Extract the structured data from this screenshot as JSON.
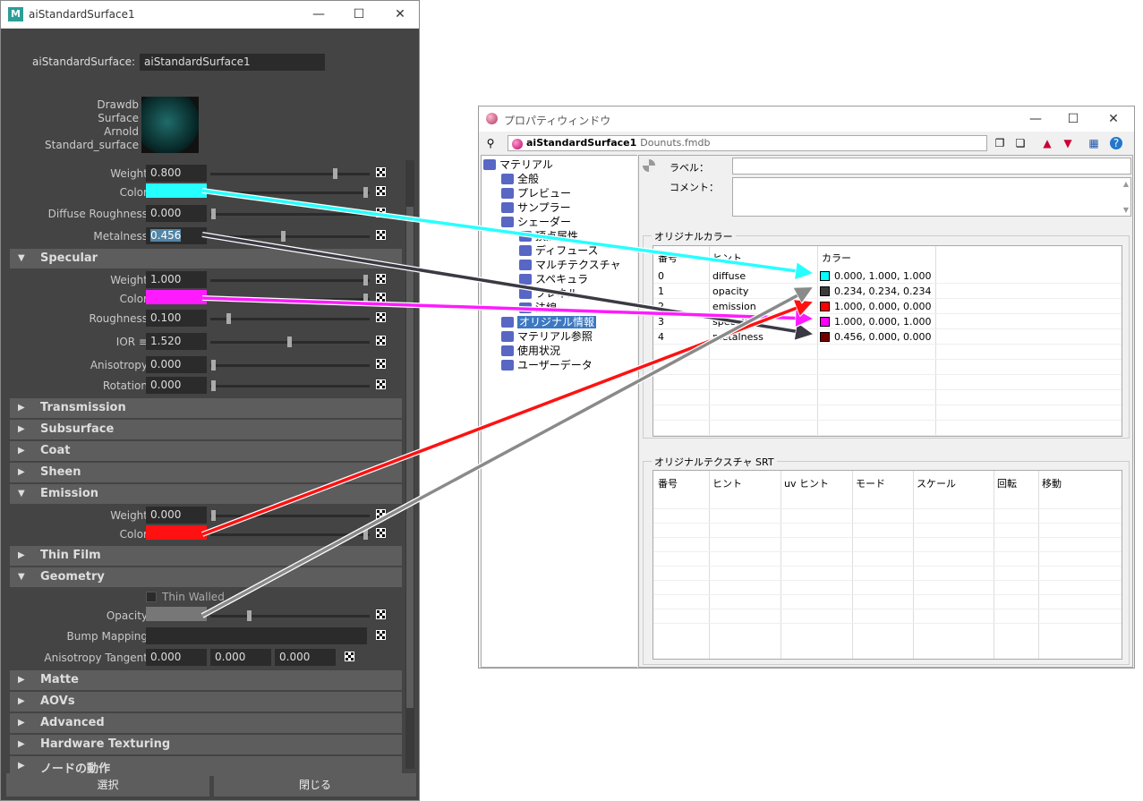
{
  "maya": {
    "title": "aiStandardSurface1",
    "logo": "M",
    "node_label": "aiStandardSurface:",
    "node_value": "aiStandardSurface1",
    "swatch_lines": [
      "Drawdb",
      "Surface",
      "Arnold",
      "Standard_surface"
    ],
    "attrs": [
      {
        "label": "Weight",
        "value": "0.800",
        "slider": 0.8
      },
      {
        "label": "Color",
        "color": "#26ffff",
        "slider": 1.0
      },
      {
        "label": "Diffuse Roughness",
        "value": "0.000",
        "slider": 0.0
      },
      {
        "label": "Metalness",
        "value": "0.456",
        "slider": 0.456,
        "selected": true
      }
    ],
    "specular": {
      "header": "Specular",
      "attrs": [
        {
          "label": "Weight",
          "value": "1.000",
          "slider": 1.0
        },
        {
          "label": "Color",
          "color": "#ff1aff",
          "slider": 1.0
        },
        {
          "label": "Roughness",
          "value": "0.100",
          "slider": 0.1
        },
        {
          "label": "IOR ≡",
          "value": "1.520",
          "slider": 0.5
        },
        {
          "label": "Anisotropy",
          "value": "0.000",
          "slider": 0.0
        },
        {
          "label": "Rotation",
          "value": "0.000",
          "slider": 0.0
        }
      ]
    },
    "sections_mid": [
      "Transmission",
      "Subsurface",
      "Coat",
      "Sheen"
    ],
    "emission": {
      "header": "Emission",
      "attrs": [
        {
          "label": "Weight",
          "value": "0.000",
          "slider": 0.0
        },
        {
          "label": "Color",
          "color": "#ff1111",
          "slider": 1.0
        }
      ]
    },
    "thin_film": "Thin Film",
    "geometry": {
      "header": "Geometry",
      "thin_walled": "Thin Walled",
      "opacity_label": "Opacity",
      "opacity_color": "#777777",
      "opacity_slider": 0.234,
      "bump_label": "Bump Mapping",
      "aniso_label": "Anisotropy Tangent",
      "aniso_values": [
        "0.000",
        "0.000",
        "0.000"
      ]
    },
    "sections_bottom": [
      "Matte",
      "AOVs",
      "Advanced",
      "Hardware Texturing",
      "ノードの動作"
    ],
    "select_button": "選択",
    "close_button": "閉じる"
  },
  "prop": {
    "title": "プロパティウィンドウ",
    "node_name": "aiStandardSurface1",
    "file": "Dounuts.fmdb",
    "tree": [
      {
        "label": "マテリアル",
        "indent": 0
      },
      {
        "label": "全般",
        "indent": 1
      },
      {
        "label": "プレビュー",
        "indent": 1
      },
      {
        "label": "サンプラー",
        "indent": 1
      },
      {
        "label": "シェーダー",
        "indent": 1
      },
      {
        "label": "頂点属性",
        "indent": 2
      },
      {
        "label": "ディフュース",
        "indent": 2
      },
      {
        "label": "マルチテクスチャ",
        "indent": 2
      },
      {
        "label": "スペキュラ",
        "indent": 2
      },
      {
        "label": "フレネル",
        "indent": 2
      },
      {
        "label": "法線",
        "indent": 2
      },
      {
        "label": "オリジナル情報",
        "indent": 1,
        "selected": true
      },
      {
        "label": "マテリアル参照",
        "indent": 1
      },
      {
        "label": "使用状況",
        "indent": 1
      },
      {
        "label": "ユーザーデータ",
        "indent": 1
      }
    ],
    "label_label": "ラベル：",
    "comment_label": "コメント：",
    "orig_color_title": "オリジナルカラー",
    "color_headers": [
      "番号",
      "ヒント",
      "カラー"
    ],
    "colors": [
      {
        "idx": "0",
        "hint": "diffuse",
        "value": "0.000, 1.000, 1.000",
        "swatch": "#00ffff"
      },
      {
        "idx": "1",
        "hint": "opacity",
        "value": "0.234, 0.234, 0.234",
        "swatch": "#3b3b3b"
      },
      {
        "idx": "2",
        "hint": "emission",
        "value": "1.000, 0.000, 0.000",
        "swatch": "#ff0000"
      },
      {
        "idx": "3",
        "hint": "specular",
        "value": "1.000, 0.000, 1.000",
        "swatch": "#ff00ff"
      },
      {
        "idx": "4",
        "hint": "metalness",
        "value": "0.456, 0.000, 0.000",
        "swatch": "#740000"
      }
    ],
    "orig_tex_title": "オリジナルテクスチャ SRT",
    "tex_headers": [
      "番号",
      "ヒント",
      "uv ヒント",
      "モード",
      "スケール",
      "回転",
      "移動"
    ]
  },
  "arrow_colors": {
    "diffuse": "#26ffff",
    "metalness": "#3a3a44",
    "specular": "#ff1aff",
    "emission": "#ff1111",
    "opacity": "#8a8a8a"
  }
}
